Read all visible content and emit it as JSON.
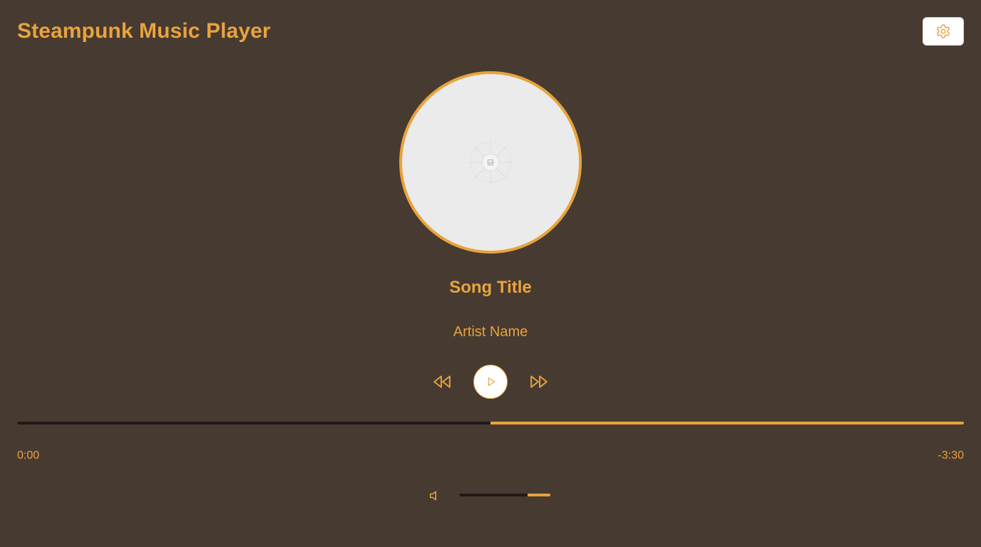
{
  "app": {
    "title": "Steampunk Music Player"
  },
  "header": {
    "settings_icon": "gear-icon"
  },
  "album": {
    "art_icon": "image-placeholder-icon"
  },
  "track": {
    "title": "Song Title",
    "artist": "Artist Name"
  },
  "controls": {
    "rewind_icon": "rewind-icon",
    "play_icon": "play-icon",
    "forward_icon": "fast-forward-icon"
  },
  "progress": {
    "played_fraction": 0.5,
    "elapsed": "0:00",
    "remaining": "-3:30"
  },
  "volume": {
    "icon": "speaker-icon",
    "level": 0.75
  },
  "colors": {
    "background": "#473a31",
    "accent": "#e8a33d",
    "track_dark": "#1f1a17",
    "disc": "#ebebeb"
  }
}
